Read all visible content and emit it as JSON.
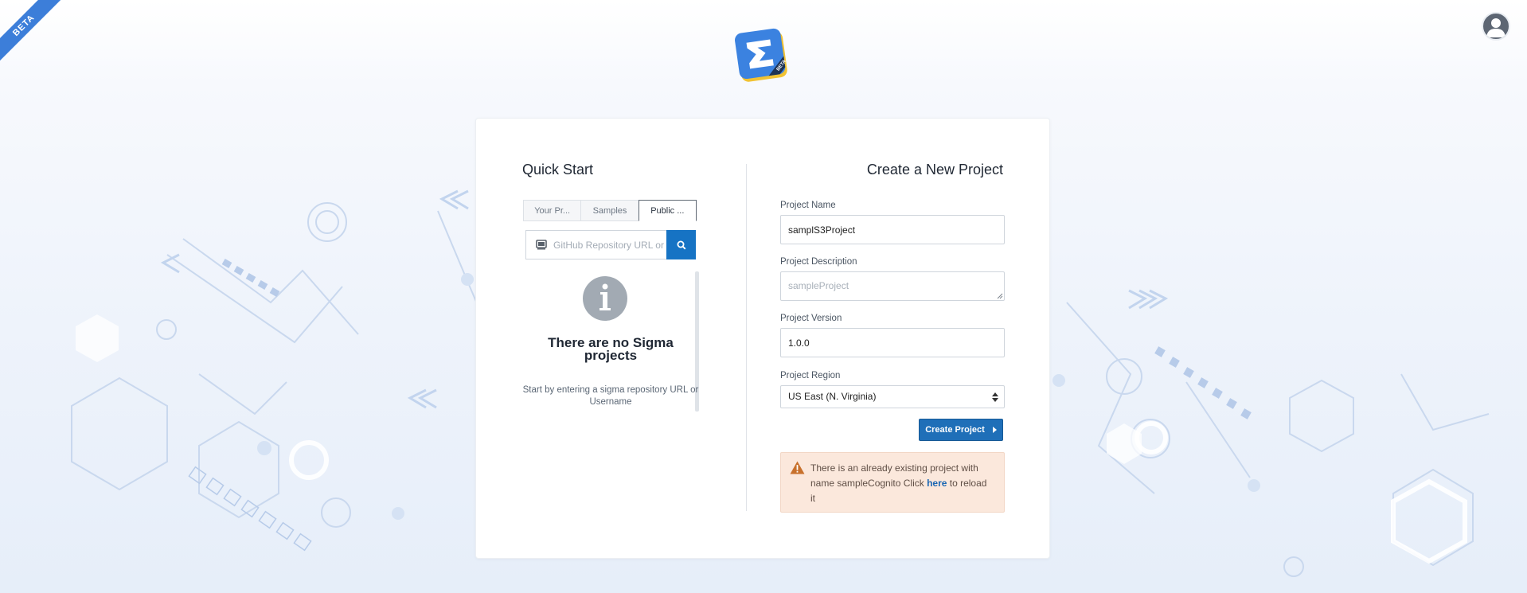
{
  "badge": {
    "ribbon_text": "BETA"
  },
  "header": {
    "logo_icon": "sigma-beta-logo-icon",
    "user_icon": "user-avatar-icon"
  },
  "quick_start": {
    "title": "Quick Start",
    "tabs": [
      {
        "label": "Your Pr...",
        "active": false
      },
      {
        "label": "Samples",
        "active": false
      },
      {
        "label": "Public ...",
        "active": true
      }
    ],
    "search": {
      "placeholder": "GitHub Repository URL or Username",
      "icon": "search-icon",
      "repo_icon": "book-icon"
    },
    "empty_state": {
      "icon": "info-icon",
      "title": "There are no Sigma projects",
      "text": "Start by entering a sigma repository URL or Username"
    }
  },
  "new_project": {
    "title": "Create a New Project",
    "name": {
      "label": "Project Name",
      "value": "samplS3Project"
    },
    "description": {
      "label": "Project Description",
      "value": "",
      "placeholder": "sampleProject"
    },
    "version": {
      "label": "Project Version",
      "value": "1.0.0"
    },
    "region": {
      "label": "Project Region",
      "selected": "US East (N. Virginia)"
    },
    "create_button": "Create Project",
    "alert": {
      "icon": "warning-icon",
      "text_before": "There is an already existing project with name sampleCognito Click ",
      "link_text": "here",
      "text_after": " to reload it"
    }
  },
  "colors": {
    "primary": "#1673c4",
    "alert_bg": "#fbe8dc",
    "warning": "#c8712c"
  }
}
